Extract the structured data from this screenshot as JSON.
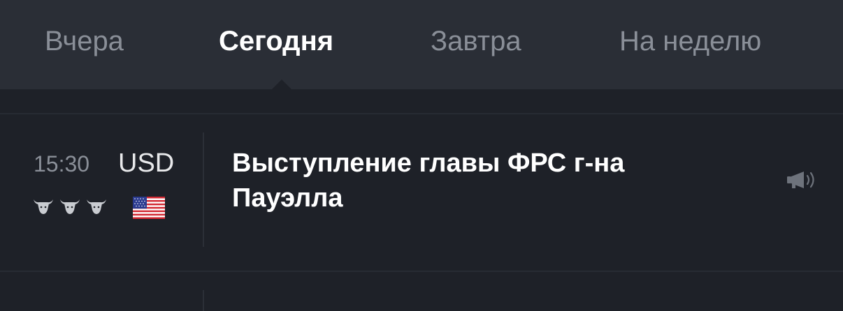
{
  "tabs": [
    {
      "label": "Вчера",
      "active": false
    },
    {
      "label": "Сегодня",
      "active": true
    },
    {
      "label": "Завтра",
      "active": false
    },
    {
      "label": "На неделю",
      "active": false
    }
  ],
  "event": {
    "time": "15:30",
    "currency": "USD",
    "importance": 3,
    "country_flag_icon": "us-flag-icon",
    "title": "Выступление главы ФРС г-на Пауэлла",
    "type_icon": "megaphone-icon"
  },
  "colors": {
    "tab_bar_bg": "#2a2e36",
    "page_bg": "#1e2128",
    "text_primary": "#ffffff",
    "text_muted": "#8a8f98"
  }
}
